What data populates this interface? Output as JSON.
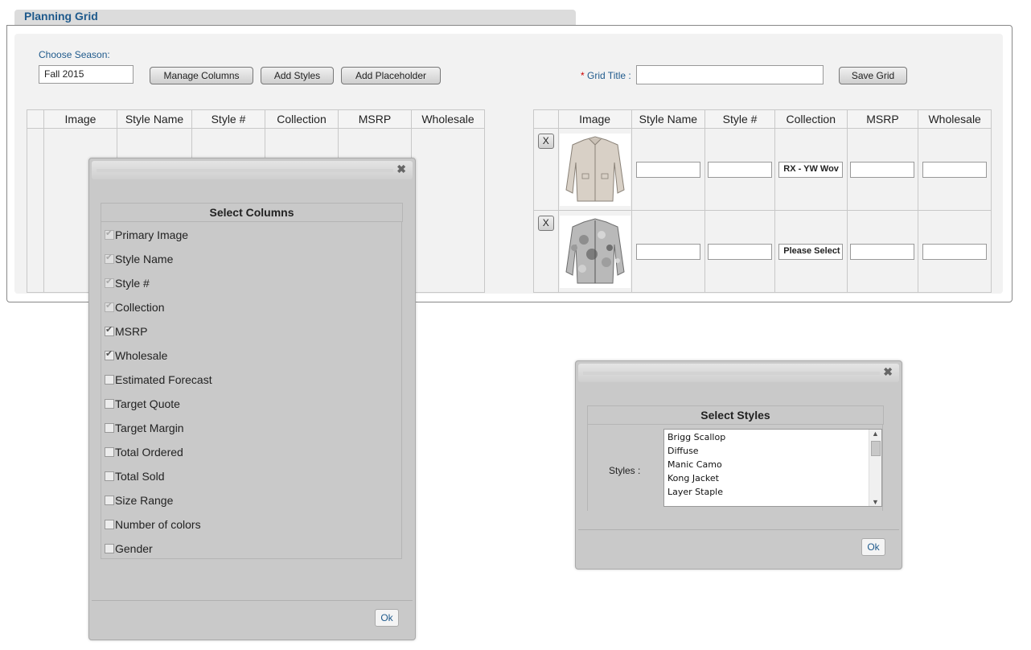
{
  "header": {
    "title": "Planning Grid"
  },
  "toolbar": {
    "season_label": "Choose Season:",
    "season_value": "Fall 2015",
    "manage_columns": "Manage Columns",
    "add_styles": "Add Styles",
    "add_placeholder": "Add Placeholder",
    "grid_title_star": "*",
    "grid_title_label": "Grid Title :",
    "grid_title_value": "",
    "save_grid": "Save Grid"
  },
  "left_grid": {
    "columns": [
      "Image",
      "Style Name",
      "Style #",
      "Collection",
      "MSRP",
      "Wholesale"
    ]
  },
  "right_grid": {
    "columns": [
      "Image",
      "Style Name",
      "Style #",
      "Collection",
      "MSRP",
      "Wholesale"
    ],
    "rows": [
      {
        "remove": "X",
        "image_icon": "jacket-image-plain",
        "style_name": "",
        "style_number": "",
        "collection": "RX - YW Wov",
        "msrp": "",
        "wholesale": ""
      },
      {
        "remove": "X",
        "image_icon": "jacket-image-camo",
        "style_name": "",
        "style_number": "",
        "collection": "Please Select",
        "msrp": "",
        "wholesale": ""
      }
    ]
  },
  "columns_dialog": {
    "close": "✖",
    "title": "Select Columns",
    "items": [
      {
        "label": "Primary Image",
        "checked": true,
        "disabled": true
      },
      {
        "label": "Style Name",
        "checked": true,
        "disabled": true
      },
      {
        "label": "Style #",
        "checked": true,
        "disabled": true
      },
      {
        "label": "Collection",
        "checked": true,
        "disabled": true
      },
      {
        "label": "MSRP",
        "checked": true,
        "disabled": false
      },
      {
        "label": "Wholesale",
        "checked": true,
        "disabled": false
      },
      {
        "label": "Estimated Forecast",
        "checked": false,
        "disabled": false
      },
      {
        "label": "Target Quote",
        "checked": false,
        "disabled": false
      },
      {
        "label": "Target Margin",
        "checked": false,
        "disabled": false
      },
      {
        "label": "Total Ordered",
        "checked": false,
        "disabled": false
      },
      {
        "label": "Total Sold",
        "checked": false,
        "disabled": false
      },
      {
        "label": "Size Range",
        "checked": false,
        "disabled": false
      },
      {
        "label": "Number of colors",
        "checked": false,
        "disabled": false
      },
      {
        "label": "Gender",
        "checked": false,
        "disabled": false
      }
    ],
    "ok": "Ok"
  },
  "styles_dialog": {
    "close": "✖",
    "title": "Select Styles",
    "styles_label": "Styles :",
    "options": [
      "Brigg Scallop",
      "Diffuse",
      "Manic Camo",
      "Kong Jacket",
      "Layer Staple"
    ],
    "ok": "Ok"
  },
  "colors": {
    "accent": "#1f5a8c",
    "required": "#cc0000",
    "dialog_bg": "#c9c9c9"
  }
}
